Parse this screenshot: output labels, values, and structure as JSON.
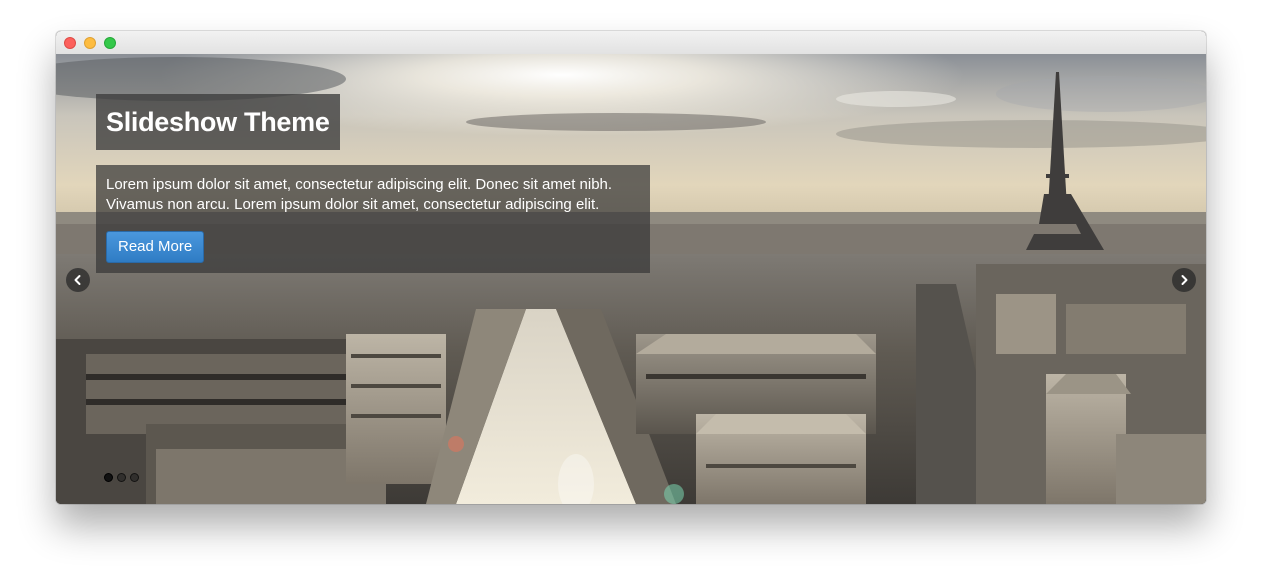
{
  "slideshow": {
    "title": "Slideshow Theme",
    "description": "Lorem ipsum dolor sit amet, consectetur adipiscing elit. Donec sit amet nibh. Vivamus non arcu. Lorem ipsum dolor sit amet, consectetur adipiscing elit.",
    "button_label": "Read More",
    "slide_count": 3,
    "active_slide": 1,
    "image_subject": "Paris skyline with Eiffel Tower"
  },
  "window": {
    "traffic_lights": [
      "close",
      "minimize",
      "zoom"
    ]
  },
  "icons": {
    "prev": "chevron-left-icon",
    "next": "chevron-right-icon"
  },
  "colors": {
    "button": "#3b88d2",
    "caption_bg": "#3c3c3c",
    "close": "#fc605c",
    "minimize": "#fdbc40",
    "zoom": "#34c84a"
  }
}
